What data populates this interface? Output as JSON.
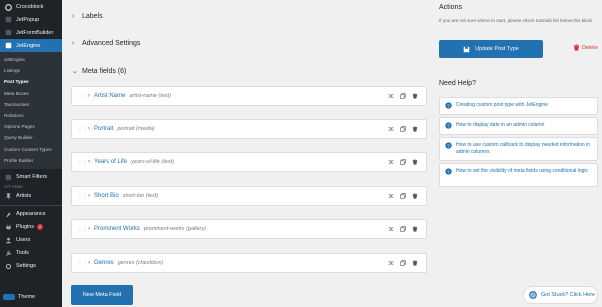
{
  "sidebar": {
    "brand": "Crocoblock",
    "plugins_top": [
      {
        "label": "JetPopup",
        "icon": "jetpopup-icon"
      },
      {
        "label": "JetFormBuilder",
        "icon": "jetformbuilder-icon"
      }
    ],
    "active": {
      "label": "JetEngine",
      "icon": "jetengine-icon"
    },
    "submenu": [
      "JetEngine",
      "Listings",
      "Post Types",
      "Meta Boxes",
      "Taxonomies",
      "Relations",
      "Options Pages",
      "Query Builder",
      "Custom Content Types",
      "Profile Builder"
    ],
    "smart_filters": "Smart Filters",
    "caption": "CPT ITEMS",
    "artists": "Artists",
    "lower": [
      {
        "label": "Appearance",
        "icon": "appearance-icon"
      },
      {
        "label": "Plugins",
        "icon": "plugins-icon",
        "badge": "2"
      },
      {
        "label": "Users",
        "icon": "users-icon"
      },
      {
        "label": "Tools",
        "icon": "tools-icon"
      },
      {
        "label": "Settings",
        "icon": "settings-icon"
      }
    ],
    "theme": "Theme"
  },
  "main": {
    "labels_section": "Labels",
    "advanced_section": "Advanced Settings",
    "meta_section": "Meta fields (6)",
    "fields": [
      {
        "name": "Artist Name",
        "meta": "artist-name (text)"
      },
      {
        "name": "Portrait",
        "meta": "portrait (media)"
      },
      {
        "name": "Years of Life",
        "meta": "years-of-life (text)"
      },
      {
        "name": "Short Bio",
        "meta": "short-bio (text)"
      },
      {
        "name": "Prominent Works",
        "meta": "prominent-works (gallery)"
      },
      {
        "name": "Genres",
        "meta": "genres (checkbox)"
      }
    ],
    "new_field_button": "New Meta Field"
  },
  "right": {
    "actions_title": "Actions",
    "actions_text": "If you are not sure where to start, please check tutorials list below this block",
    "update_button": "Update Post Type",
    "delete_button": "Delete",
    "help_title": "Need Help?",
    "help_links": [
      "Creating custom post type with JetEngine",
      "How to display date in an admin column",
      "How to use custom callback to display needed information in admin columns",
      "How to set the visibility of meta fields using conditional logic"
    ],
    "stuck_button": "Got Stuck? Click Here"
  },
  "colors": {
    "accent": "#2271b1",
    "sidebar": "#1d2327",
    "danger": "#d63638"
  }
}
